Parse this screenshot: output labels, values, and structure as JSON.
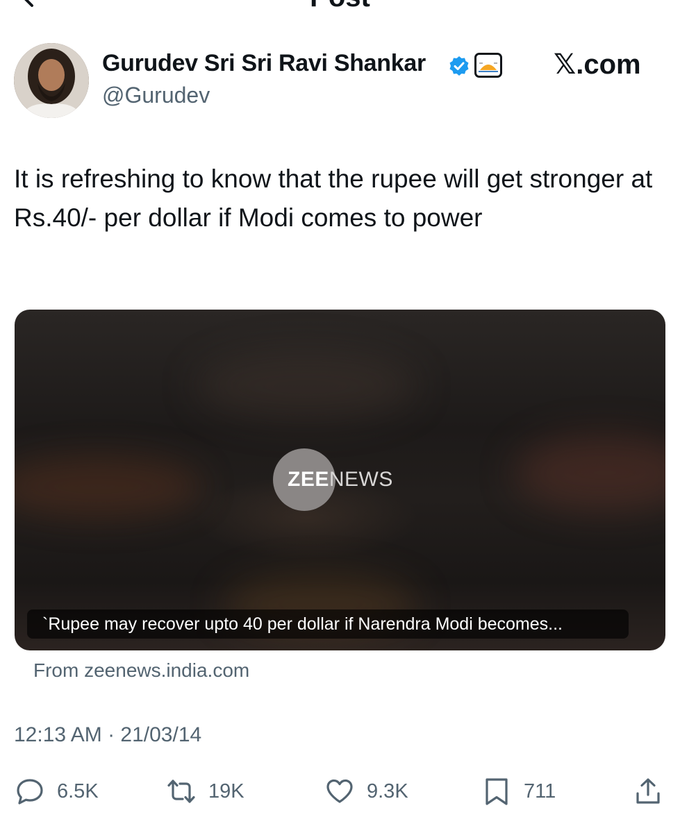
{
  "header": {
    "title": "Post"
  },
  "author": {
    "name": "Gurudev Sri Sri Ravi Shankar",
    "handle": "@Gurudev"
  },
  "watermark": "𝕏.com",
  "tweet": {
    "text": "It is refreshing to know that the rupee will get stronger at Rs.40/- per dollar if Modi comes to power"
  },
  "media": {
    "logo_bold": "ZEE",
    "logo_light": "NEWS",
    "caption": "`Rupee may recover upto 40 per dollar if Narendra Modi becomes...",
    "source": "From zeenews.india.com"
  },
  "meta": {
    "timestamp": "12:13 AM · 21/03/14"
  },
  "actions": {
    "replies": "6.5K",
    "reposts": "19K",
    "likes": "9.3K",
    "bookmarks": "711"
  },
  "colors": {
    "text": "#0f1419",
    "secondary": "#536471",
    "verified": "#1d9bf0"
  }
}
